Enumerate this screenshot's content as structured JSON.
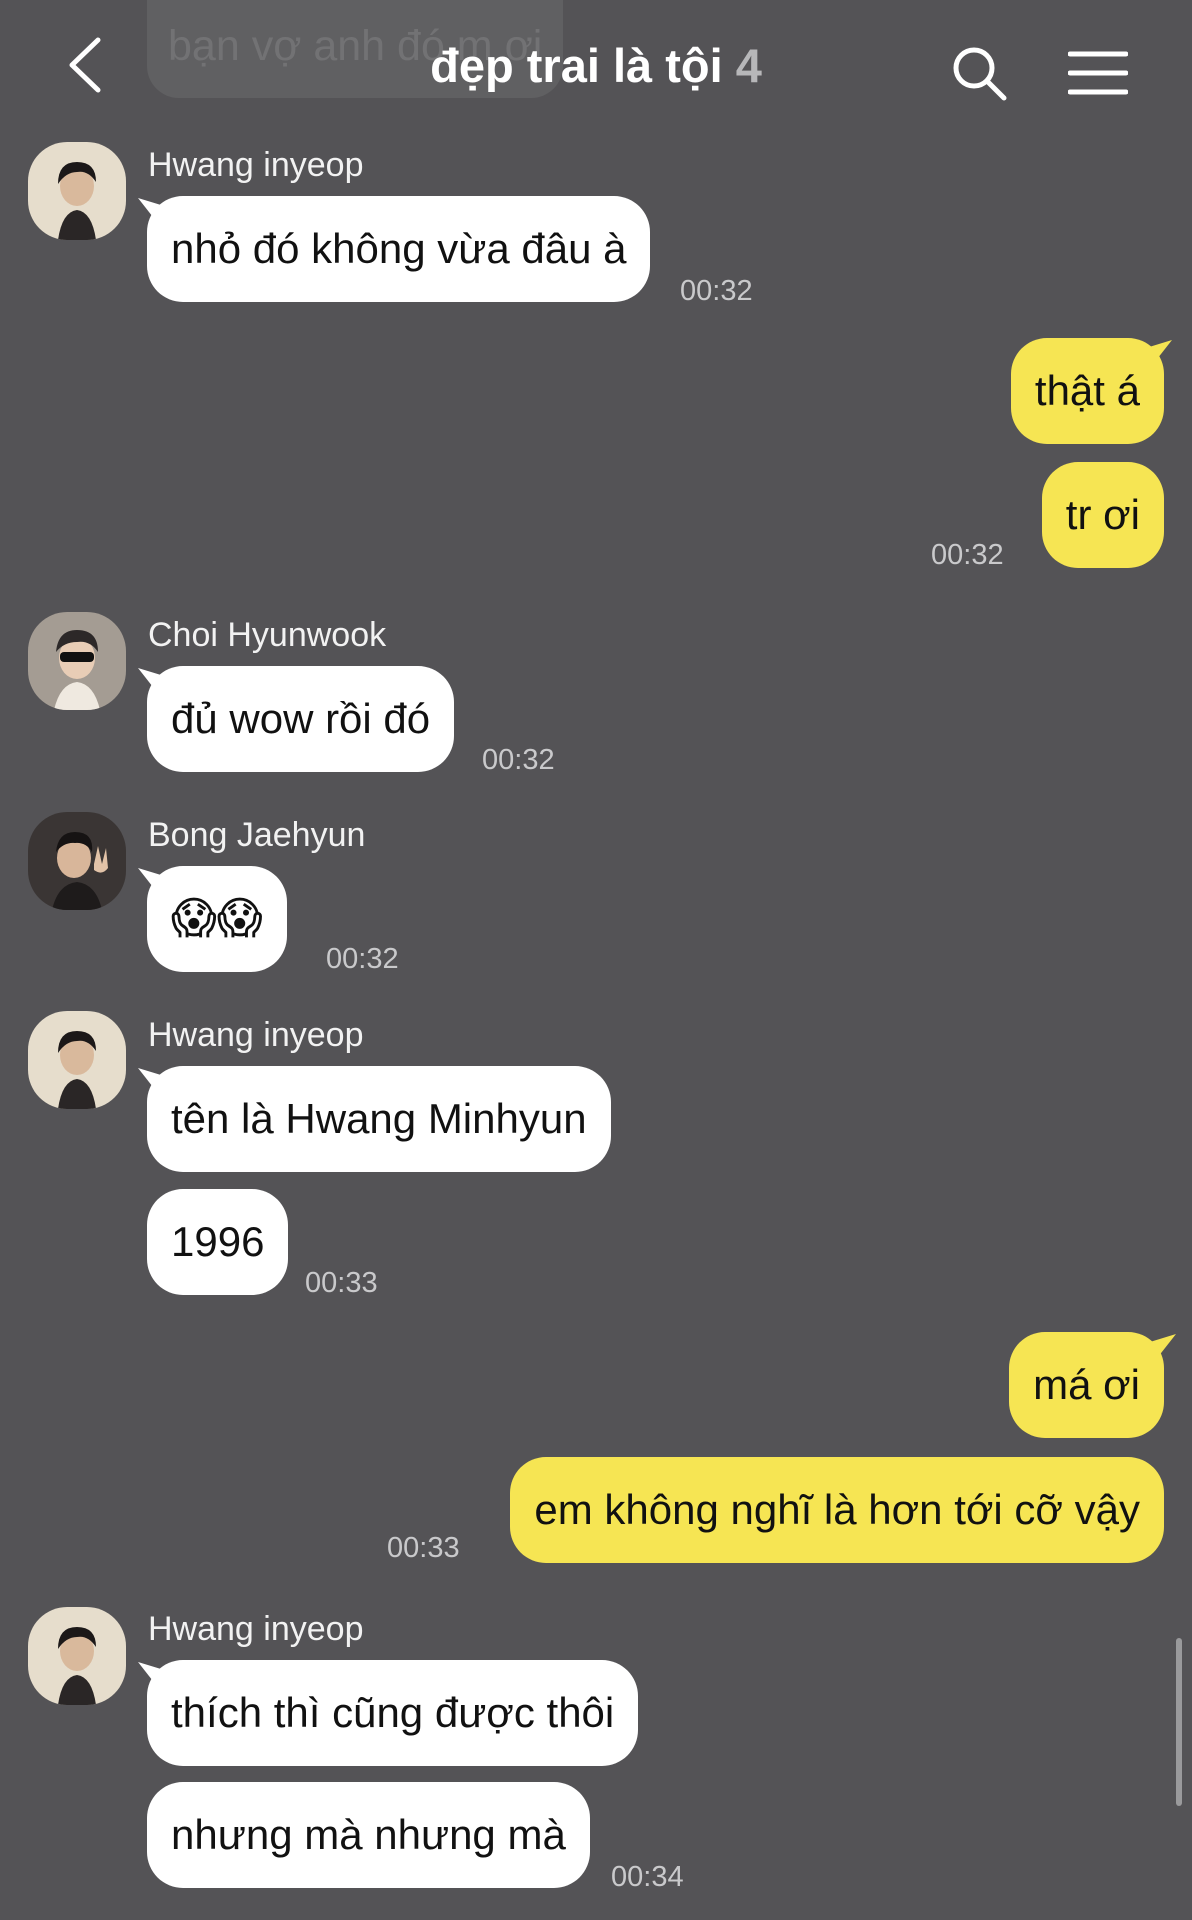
{
  "header": {
    "title": "đẹp trai là tội",
    "member_count": "4",
    "back_icon": "chevron-left-icon",
    "search_icon": "search-icon",
    "menu_icon": "menu-icon"
  },
  "ghost_message": "bạn vợ anh đó m ơi",
  "messages": [
    {
      "sender": "Hwang inyeop",
      "texts": [
        "nhỏ đó không vừa đâu à"
      ],
      "time": "00:32"
    },
    {
      "texts": [
        "thật á",
        "tr ơi"
      ],
      "time": "00:32"
    },
    {
      "sender": "Choi Hyunwook",
      "texts": [
        "đủ wow rồi đó"
      ],
      "time": "00:32"
    },
    {
      "sender": "Bong Jaehyun",
      "texts": [
        "😱😱"
      ],
      "time": "00:32"
    },
    {
      "sender": "Hwang inyeop",
      "texts": [
        "tên là Hwang Minhyun",
        "1996"
      ],
      "time": "00:33"
    },
    {
      "texts": [
        "má ơi",
        "em không nghĩ là hơn tới cỡ vậy"
      ],
      "time": "00:33"
    },
    {
      "sender": "Hwang inyeop",
      "texts": [
        "thích thì cũng được thôi",
        "nhưng mà nhưng mà"
      ],
      "time": "00:34"
    }
  ],
  "colors": {
    "background": "#545356",
    "incoming_bubble": "#ffffff",
    "outgoing_bubble": "#f6e553"
  }
}
